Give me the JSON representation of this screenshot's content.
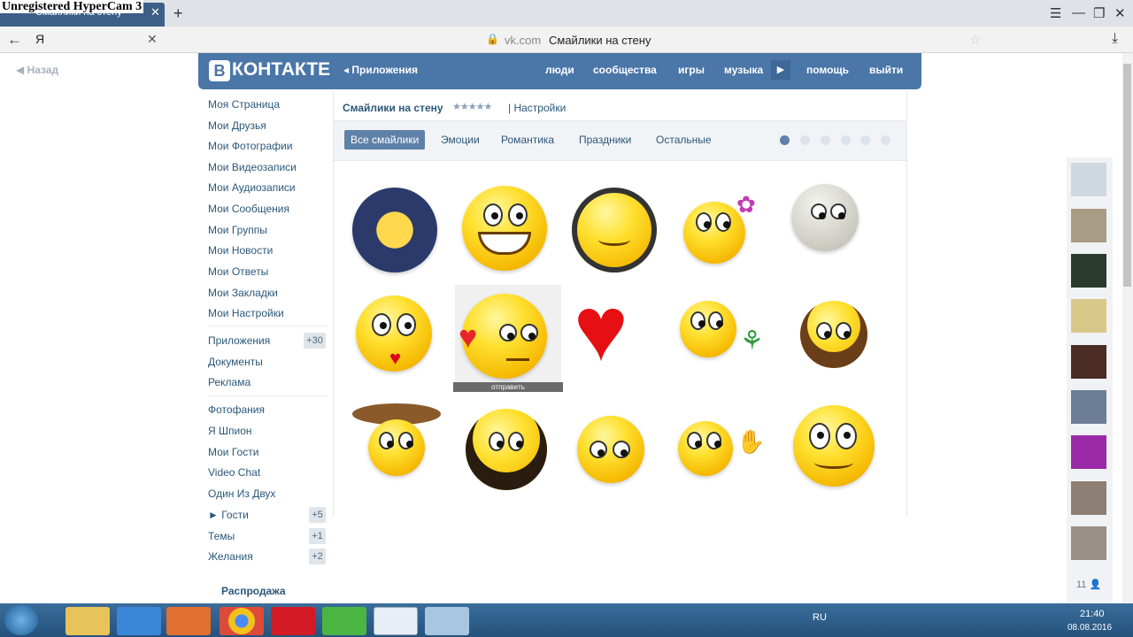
{
  "overlay": {
    "watermark": "Unregistered HyperCam 3"
  },
  "browser": {
    "tab_title": "Смайлики на стену",
    "new_tab": "+",
    "tab_close": "✕",
    "address_input": "Я",
    "omni_domain": "vk.com",
    "omni_title": "Смайлики на стену"
  },
  "vk": {
    "logo_letter": "В",
    "logo_text": "КОНТАКТЕ",
    "apps_link": "◂ Приложения",
    "nav": [
      "люди",
      "сообщества",
      "игры",
      "музыка",
      "помощь",
      "выйти"
    ],
    "back": "Назад"
  },
  "menu": {
    "items": [
      "Моя Страница",
      "Мои Друзья",
      "Мои Фотографии",
      "Мои Видеозаписи",
      "Мои Аудиозаписи",
      "Мои Сообщения",
      "Мои Группы",
      "Мои Новости",
      "Мои Ответы",
      "Мои Закладки",
      "Мои Настройки"
    ],
    "apps": [
      "Приложения",
      "Документы",
      "Реклама"
    ],
    "apps_badge": "+30",
    "extras": [
      "Фотофания",
      "Я Шпион",
      "Мои Гости",
      "Video Chat",
      "Один Из Двух",
      "► Гости",
      "Темы",
      "Желания"
    ],
    "badges": {
      "guests": "+5",
      "themes": "+1",
      "wishes": "+2"
    },
    "sale": "Распродажа"
  },
  "app": {
    "title": "Смайлики на стену",
    "stars": "★★★★★",
    "settings": "| Настройки",
    "categories": [
      "Все смайлики",
      "Эмоции",
      "Романтика",
      "Праздники",
      "Остальные"
    ],
    "send_label": "отправить"
  },
  "sidebar": {
    "friend_count": "11 👤"
  },
  "taskbar": {
    "lang": "RU",
    "time": "21:40",
    "date": "08.08.2016"
  },
  "colors": {
    "vk_blue": "#4a76a8",
    "link": "#2b587a",
    "active_tab": "#5e81a8"
  }
}
